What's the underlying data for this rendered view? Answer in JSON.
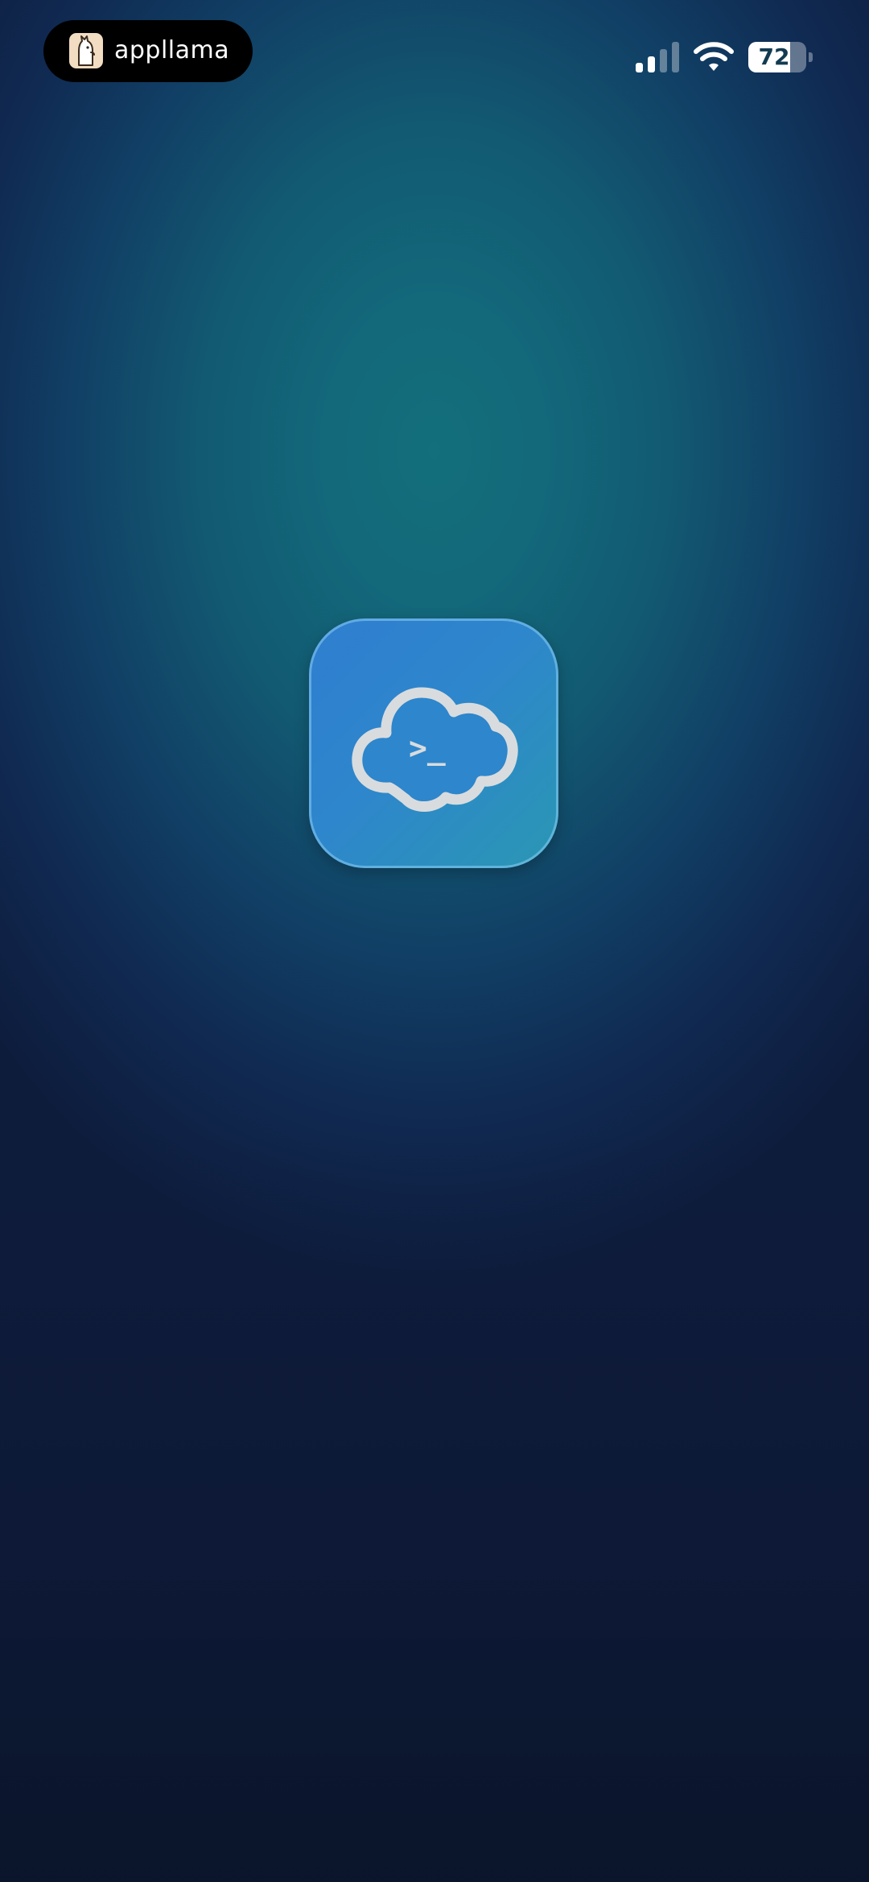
{
  "status_bar": {
    "recorder_label": "appllama",
    "recorder_logo_icon": "llama-icon",
    "signal_icon": "cellular-signal-icon",
    "signal_bars_active": 2,
    "signal_bars_total": 4,
    "wifi_icon": "wifi-icon",
    "battery_icon": "battery-icon",
    "battery_level": "72",
    "battery_fraction": 0.72
  },
  "launch_screen": {
    "app_icon": "terminal-cloud-icon",
    "prompt_glyph": ">_"
  },
  "colors": {
    "background_center": "#136f7b",
    "background_edge": "#0e1c3c",
    "icon_gradient_start": "#2f7ed0",
    "icon_gradient_end": "#2a97b3",
    "cloud_stroke": "#d8dcde"
  }
}
